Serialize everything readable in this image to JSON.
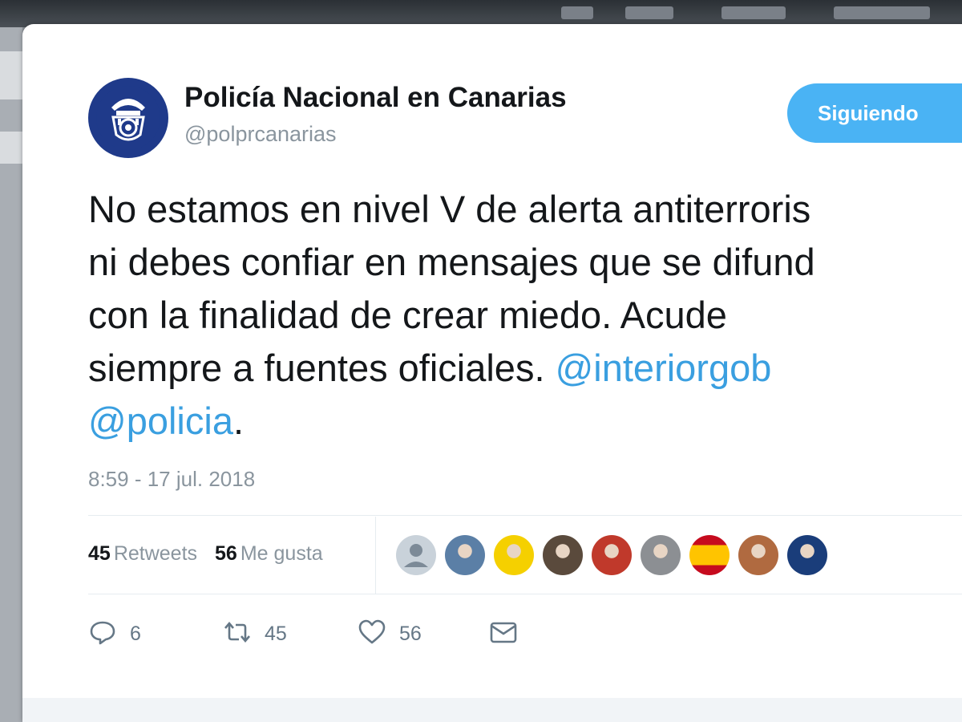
{
  "tweet": {
    "author": {
      "display_name": "Policía Nacional en Canarias",
      "handle": "@polprcanarias",
      "avatar_icon": "police-badge-icon"
    },
    "follow_button_label": "Siguiendo",
    "text_lines": [
      "No estamos en nivel V de alerta antiterroris",
      "ni debes confiar en mensajes que se difund",
      "con la finalidad de crear miedo. Acude",
      "siempre a fuentes oficiales. "
    ],
    "mentions": [
      "@interiorgob",
      "@policia"
    ],
    "text_end_punct": ".",
    "timestamp": "8:59 - 17 jul. 2018",
    "stats": {
      "retweets_count": "45",
      "retweets_label": "Retweets",
      "likes_count": "56",
      "likes_label": "Me gusta"
    },
    "liker_avatars": [
      {
        "icon": "default-profile-icon",
        "color": "#c9d2da"
      },
      {
        "icon": "user-avatar-icon",
        "color": "#5b7fa6"
      },
      {
        "icon": "user-avatar-icon",
        "color": "#f5d000"
      },
      {
        "icon": "user-avatar-icon",
        "color": "#5a4a3c"
      },
      {
        "icon": "user-avatar-icon",
        "color": "#c0392b"
      },
      {
        "icon": "user-avatar-icon",
        "color": "#8c8f93"
      },
      {
        "icon": "spain-flag-icon",
        "color": "#e8a317"
      },
      {
        "icon": "user-avatar-icon",
        "color": "#b06a40"
      },
      {
        "icon": "user-avatar-icon",
        "color": "#1a3d7a"
      }
    ],
    "actions": {
      "reply_count": "6",
      "retweet_count": "45",
      "like_count": "56"
    }
  },
  "colors": {
    "accent": "#4ab3f4",
    "mention": "#3a9fe0",
    "muted": "#8a959e",
    "text": "#14171a"
  }
}
